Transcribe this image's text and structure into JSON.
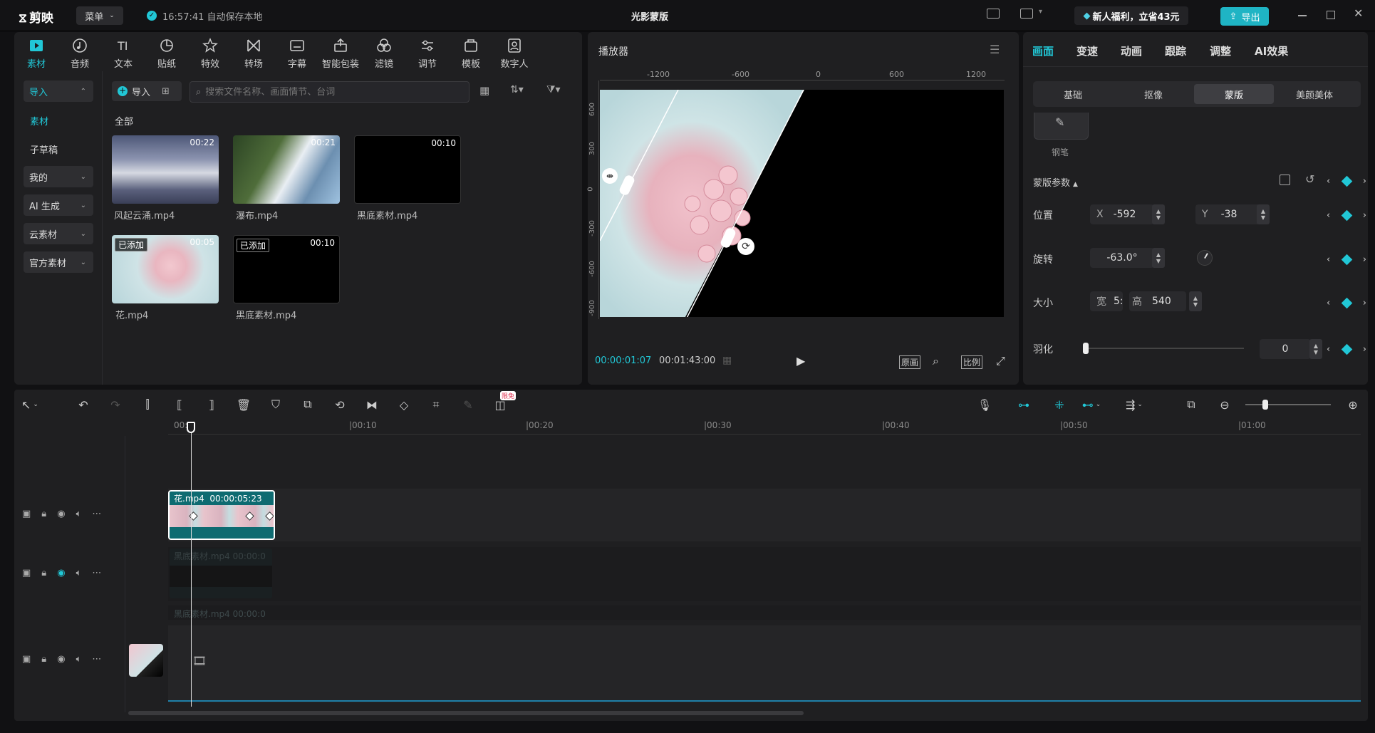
{
  "app": {
    "logo_text": "剪映",
    "menu_label": "菜单",
    "save_status": "16:57:41 自动保存本地",
    "project_title": "光影蒙版",
    "promo": "新人福利，立省43元",
    "export_label": "导出"
  },
  "toolbar": {
    "items": [
      {
        "label": "素材",
        "icon": "media-icon"
      },
      {
        "label": "音频",
        "icon": "audio-icon"
      },
      {
        "label": "文本",
        "icon": "text-icon"
      },
      {
        "label": "贴纸",
        "icon": "sticker-icon"
      },
      {
        "label": "特效",
        "icon": "effects-icon"
      },
      {
        "label": "转场",
        "icon": "transition-icon"
      },
      {
        "label": "字幕",
        "icon": "subtitle-icon"
      },
      {
        "label": "智能包装",
        "icon": "smart-pack-icon"
      },
      {
        "label": "滤镜",
        "icon": "filter-icon"
      },
      {
        "label": "调节",
        "icon": "adjust-icon"
      },
      {
        "label": "模板",
        "icon": "template-icon"
      },
      {
        "label": "数字人",
        "icon": "digital-human-icon"
      }
    ]
  },
  "sidebar": {
    "import": "导入",
    "material": "素材",
    "subdraft": "子草稿",
    "mine": "我的",
    "ai": "AI 生成",
    "cloud": "云素材",
    "official": "官方素材"
  },
  "media": {
    "import_btn": "导入",
    "search_placeholder": "搜索文件名称、画面情节、台词",
    "all_label": "全部",
    "items": [
      {
        "name": "风起云涌.mp4",
        "duration": "00:22",
        "tag": ""
      },
      {
        "name": "瀑布.mp4",
        "duration": "00:21",
        "tag": ""
      },
      {
        "name": "黑底素材.mp4",
        "duration": "00:10",
        "tag": ""
      },
      {
        "name": "花.mp4",
        "duration": "00:05",
        "tag": "已添加"
      },
      {
        "name": "黑底素材.mp4",
        "duration": "00:10",
        "tag": "已添加"
      }
    ]
  },
  "player": {
    "title": "播放器",
    "current_time": "00:00:01:07",
    "total_time": "00:01:43:00",
    "original_btn": "原画",
    "ratio_btn": "比例",
    "ruler_h": [
      "-1200",
      "-600",
      "0",
      "600",
      "1200"
    ],
    "ruler_v": [
      "600",
      "300",
      "0",
      "-300",
      "-600",
      "-900"
    ]
  },
  "inspector": {
    "tabs": [
      "画面",
      "变速",
      "动画",
      "跟踪",
      "调整",
      "AI效果"
    ],
    "subtabs": [
      "基础",
      "抠像",
      "蒙版",
      "美颜美体"
    ],
    "brush_label": "钢笔",
    "section": "蒙版参数",
    "position_label": "位置",
    "x_label": "X",
    "x_value": "-592",
    "y_label": "Y",
    "y_value": "-38",
    "rotation_label": "旋转",
    "rotation_value": "-63.0°",
    "size_label": "大小",
    "w_label": "宽",
    "w_value": "5:",
    "h_label": "高",
    "h_value": "540",
    "feather_label": "羽化",
    "feather_value": "0",
    "feather_level": 0.0
  },
  "timeline": {
    "ticks": [
      "00:0",
      "|00:10",
      "|00:20",
      "|00:30",
      "|00:40",
      "|00:50",
      "|01:00"
    ],
    "clip1_label": "花.mp4",
    "clip1_duration": "00:00:05:23",
    "clip2_label": "黑底素材.mp4",
    "clip2_duration": "00:00:0",
    "clip3_label": "黑底素材.mp4",
    "clip3_duration": "00:00:0",
    "limited_badge": "限免"
  },
  "colors": {
    "accent": "#21c7d6",
    "panel": "#1f1f21",
    "bg": "#111113"
  }
}
